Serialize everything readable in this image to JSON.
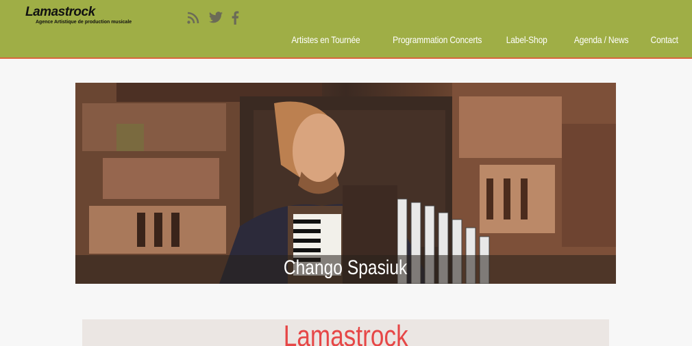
{
  "brand": {
    "name": "Lamastrock",
    "tagline": "Agence Artistique de production musicale"
  },
  "social": {
    "icons": [
      "rss-icon",
      "twitter-icon",
      "facebook-icon"
    ]
  },
  "nav": {
    "items": [
      {
        "label": "Artistes en Tournée"
      },
      {
        "label": "Programmation Concerts"
      },
      {
        "label": "Label-Shop"
      },
      {
        "label": "Agenda / News"
      },
      {
        "label": "Contact"
      }
    ]
  },
  "hero": {
    "caption": "Chango Spasiuk"
  },
  "section": {
    "title": "Lamastrock"
  },
  "colors": {
    "header": "#9fae46",
    "header_border": "#d9653b",
    "title": "#e64747"
  }
}
